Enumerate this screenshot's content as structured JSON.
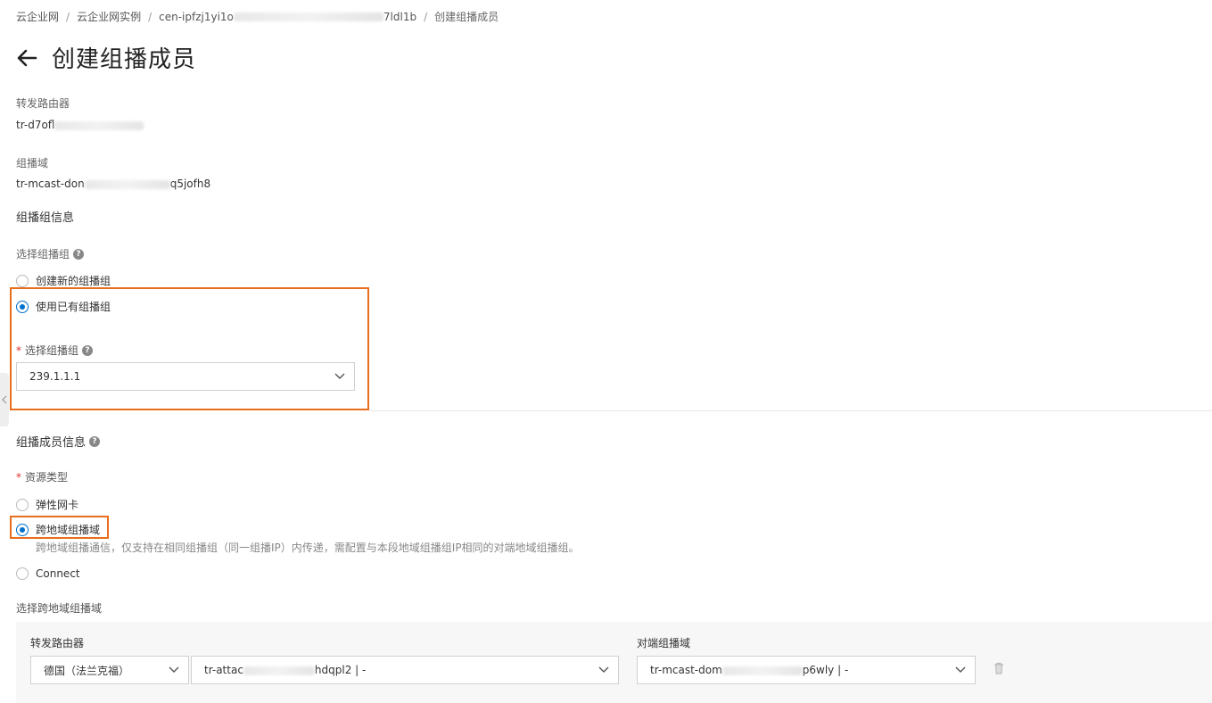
{
  "breadcrumb": {
    "item1": "云企业网",
    "item2": "云企业网实例",
    "item3_prefix": "cen-ipfzj1yi1o",
    "item3_suffix": "7ldl1b",
    "current": "创建组播成员",
    "separator": "/"
  },
  "header": {
    "title": "创建组播成员"
  },
  "router": {
    "label": "转发路由器",
    "value_prefix": "tr-d7ofl"
  },
  "domain": {
    "label": "组播域",
    "value_prefix": "tr-mcast-don",
    "value_suffix": "q5jofh8"
  },
  "group_info": {
    "title": "组播组信息",
    "select_label": "选择组播组",
    "options": [
      "创建新的组播组",
      "使用已有组播组"
    ],
    "selected_index": 1,
    "field_label": "选择组播组",
    "field_value": "239.1.1.1"
  },
  "member_info": {
    "title": "组播成员信息",
    "resource_type_label": "资源类型",
    "options": [
      "弹性网卡",
      "跨地域组播域",
      "Connect"
    ],
    "selected_index": 1,
    "hint": "跨地域组播通信，仅支持在相同组播组（同一组播IP）内传递，需配置与本段地域组播组IP相同的对端地域组播组。",
    "cross_region_label": "选择跨地域组播域"
  },
  "cross_region": {
    "router_col": "转发路由器",
    "peer_col": "对端组播域",
    "region_value": "德国（法兰克福）",
    "attach_prefix": "tr-attac",
    "attach_suffix": "hdqpl2 | -",
    "peer_prefix": "tr-mcast-dom",
    "peer_suffix": "p6wly | -"
  },
  "colors": {
    "accent": "#0070cc",
    "highlight": "#e86d1c",
    "required": "#d93026"
  },
  "icons": {
    "back": "arrow-left-icon",
    "help": "question-circle-icon",
    "chevron": "chevron-down-icon",
    "trash": "trash-icon",
    "collapse": "chevron-left-icon"
  }
}
